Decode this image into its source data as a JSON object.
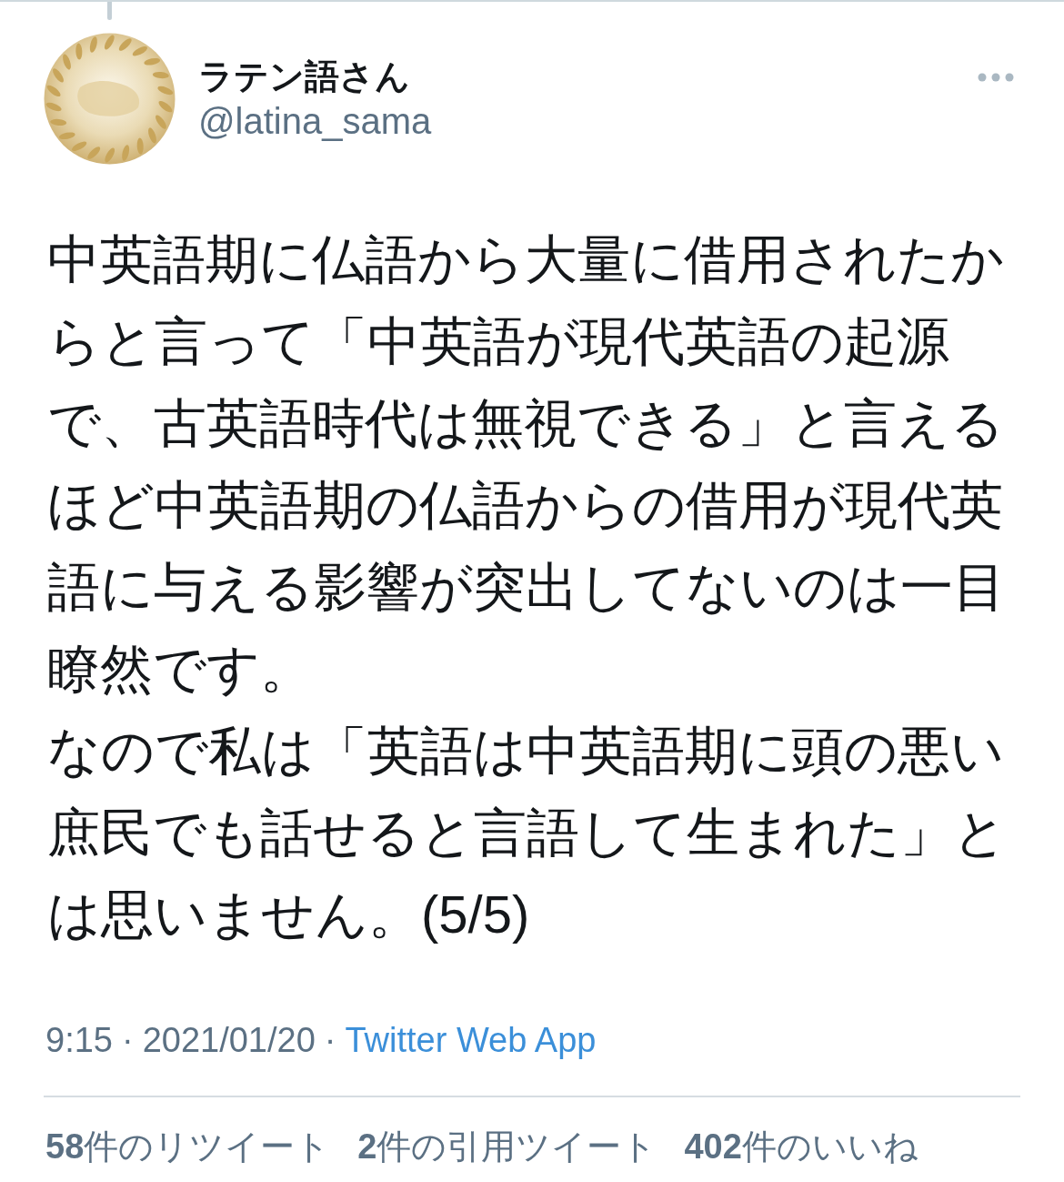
{
  "tweet": {
    "author": {
      "display_name": "ラテン語さん",
      "handle": "@latina_sama"
    },
    "paragraphs": [
      "中英語期に仏語から大量に借用されたからと言って「中英語が現代英語の起源で、古英語時代は無視できる」と言えるほど中英語期の仏語からの借用が現代英語に与える影響が突出してないのは一目瞭然です。",
      "なので私は「英語は中英語期に頭の悪い庶民でも話せると言語して生まれた」とは思いません。(5/5)"
    ],
    "meta": [
      {
        "kind": "text",
        "text": "9:15"
      },
      {
        "kind": "separator",
        "text": "·"
      },
      {
        "kind": "text",
        "text": "2021/01/20"
      },
      {
        "kind": "separator",
        "text": "·"
      },
      {
        "kind": "link",
        "text": "Twitter Web App"
      }
    ],
    "stats": [
      {
        "text": "**58**件のリツイート"
      },
      {
        "text": "**2**件の引用ツイート"
      },
      {
        "text": "**402**件のいいね"
      }
    ]
  }
}
